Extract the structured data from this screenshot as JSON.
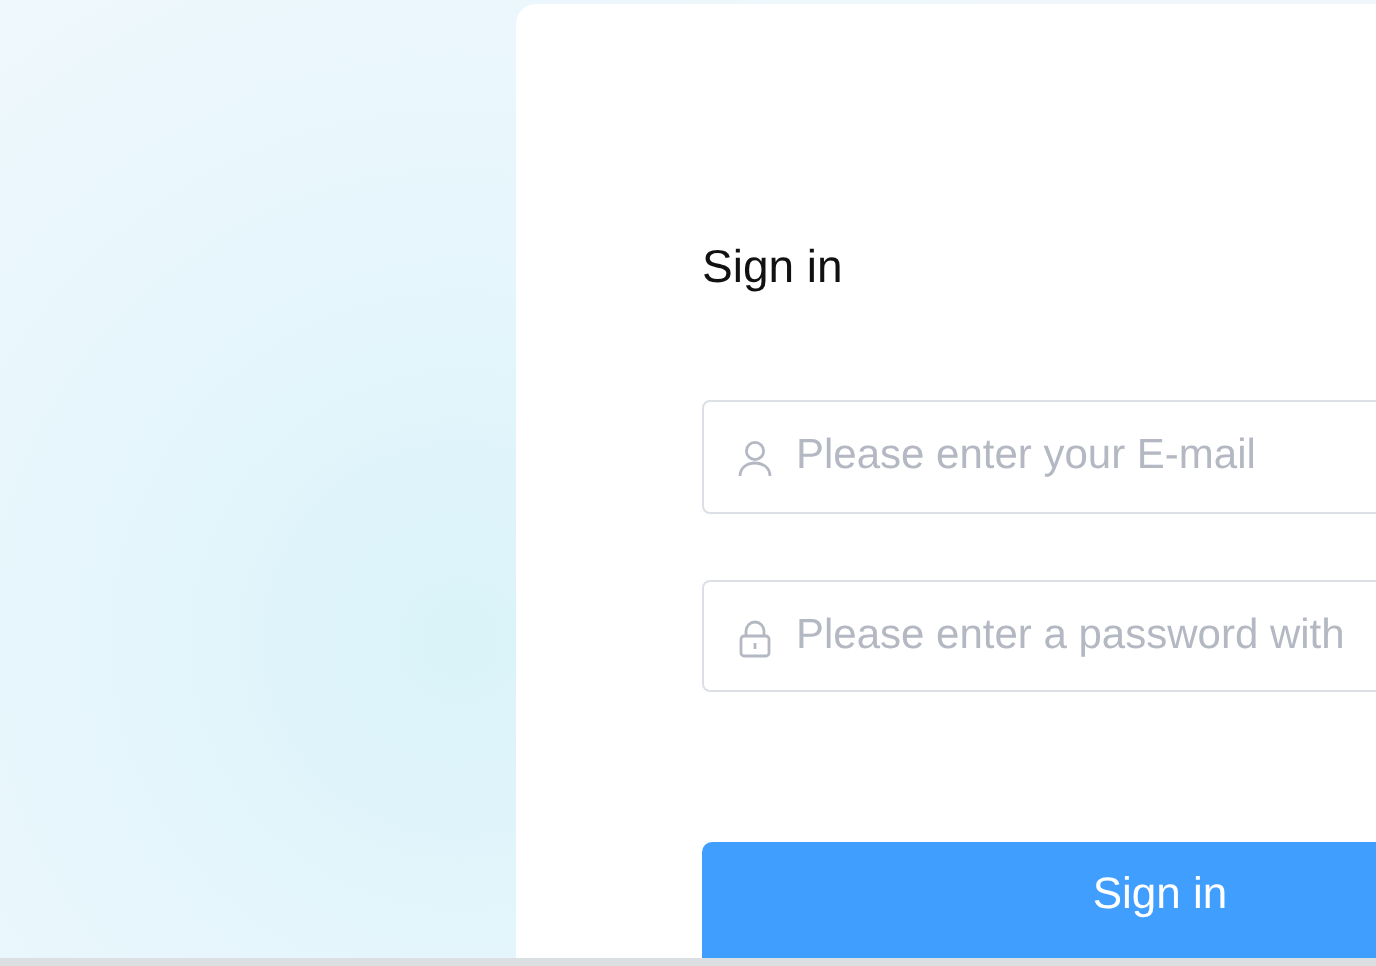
{
  "form": {
    "title": "Sign in",
    "fields": [
      {
        "kind": "email",
        "placeholder": "Please enter your E-mail"
      },
      {
        "kind": "password",
        "placeholder": "Please enter a password with"
      }
    ],
    "submit": "Sign in"
  }
}
